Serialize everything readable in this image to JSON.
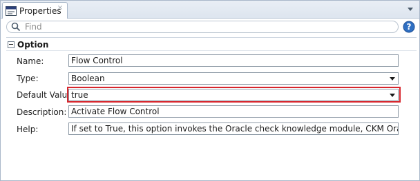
{
  "panel": {
    "tab_label": "Properties",
    "close_glyph": "×",
    "tab_icon": "properties-icon"
  },
  "search": {
    "placeholder": "Find"
  },
  "section": {
    "title": "Option"
  },
  "fields": {
    "name": {
      "label": "Name:",
      "value": "Flow Control"
    },
    "type": {
      "label": "Type:",
      "value": "Boolean"
    },
    "default_value": {
      "label": "Default Value:",
      "value": "true"
    },
    "description": {
      "label": "Description:",
      "value": "Activate Flow Control"
    },
    "help": {
      "label": "Help:",
      "value": "If set to True, this option invokes the Oracle check knowledge module, CKM Oracle, to validate the"
    }
  },
  "colors": {
    "highlight": "#d7262d",
    "help_icon": "#2f6fc2"
  }
}
